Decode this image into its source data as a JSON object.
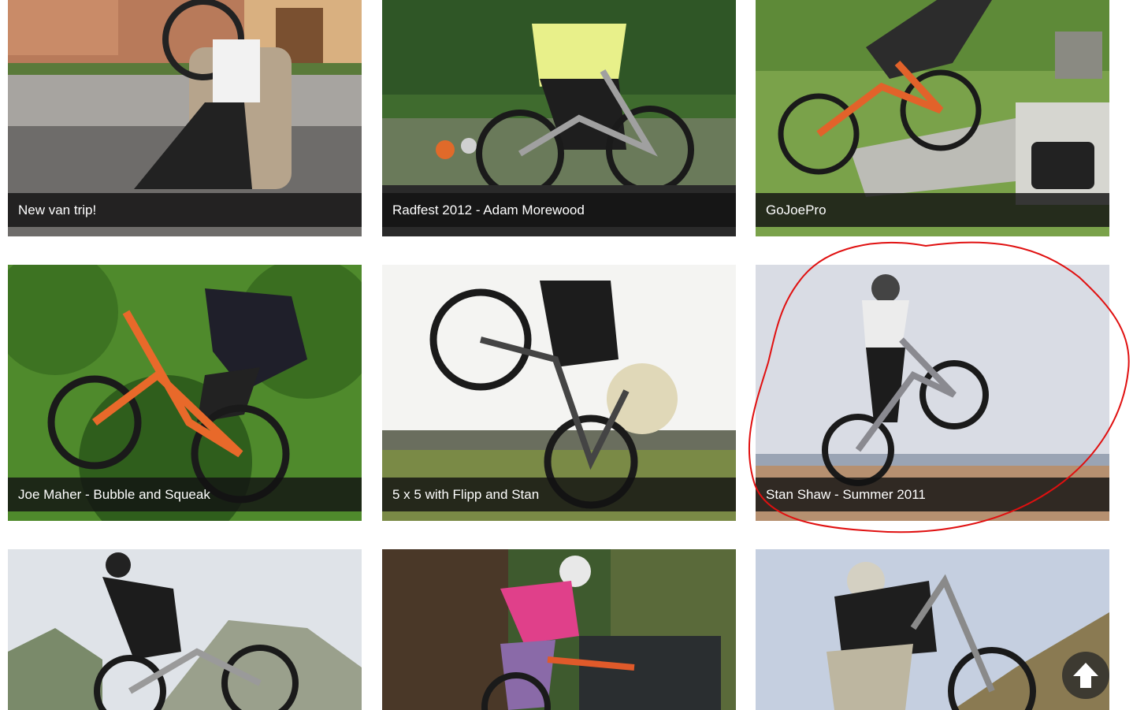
{
  "videos": [
    {
      "title": "New van trip!",
      "scene": "street"
    },
    {
      "title": "Radfest 2012 - Adam Morewood",
      "scene": "event"
    },
    {
      "title": "GoJoePro",
      "scene": "park"
    },
    {
      "title": "Joe Maher - Bubble and Squeak",
      "scene": "trees"
    },
    {
      "title": "5 x 5 with Flipp and Stan",
      "scene": "bright"
    },
    {
      "title": "Stan Shaw - Summer 2011",
      "scene": "sky"
    },
    {
      "title": "",
      "scene": "mountain"
    },
    {
      "title": "",
      "scene": "garden"
    },
    {
      "title": "",
      "scene": "hill"
    }
  ],
  "scroll_to_top": {
    "icon": "arrow-up-icon"
  },
  "annotation": {
    "color": "#e01010",
    "target": "Stan Shaw - Summer 2011"
  }
}
